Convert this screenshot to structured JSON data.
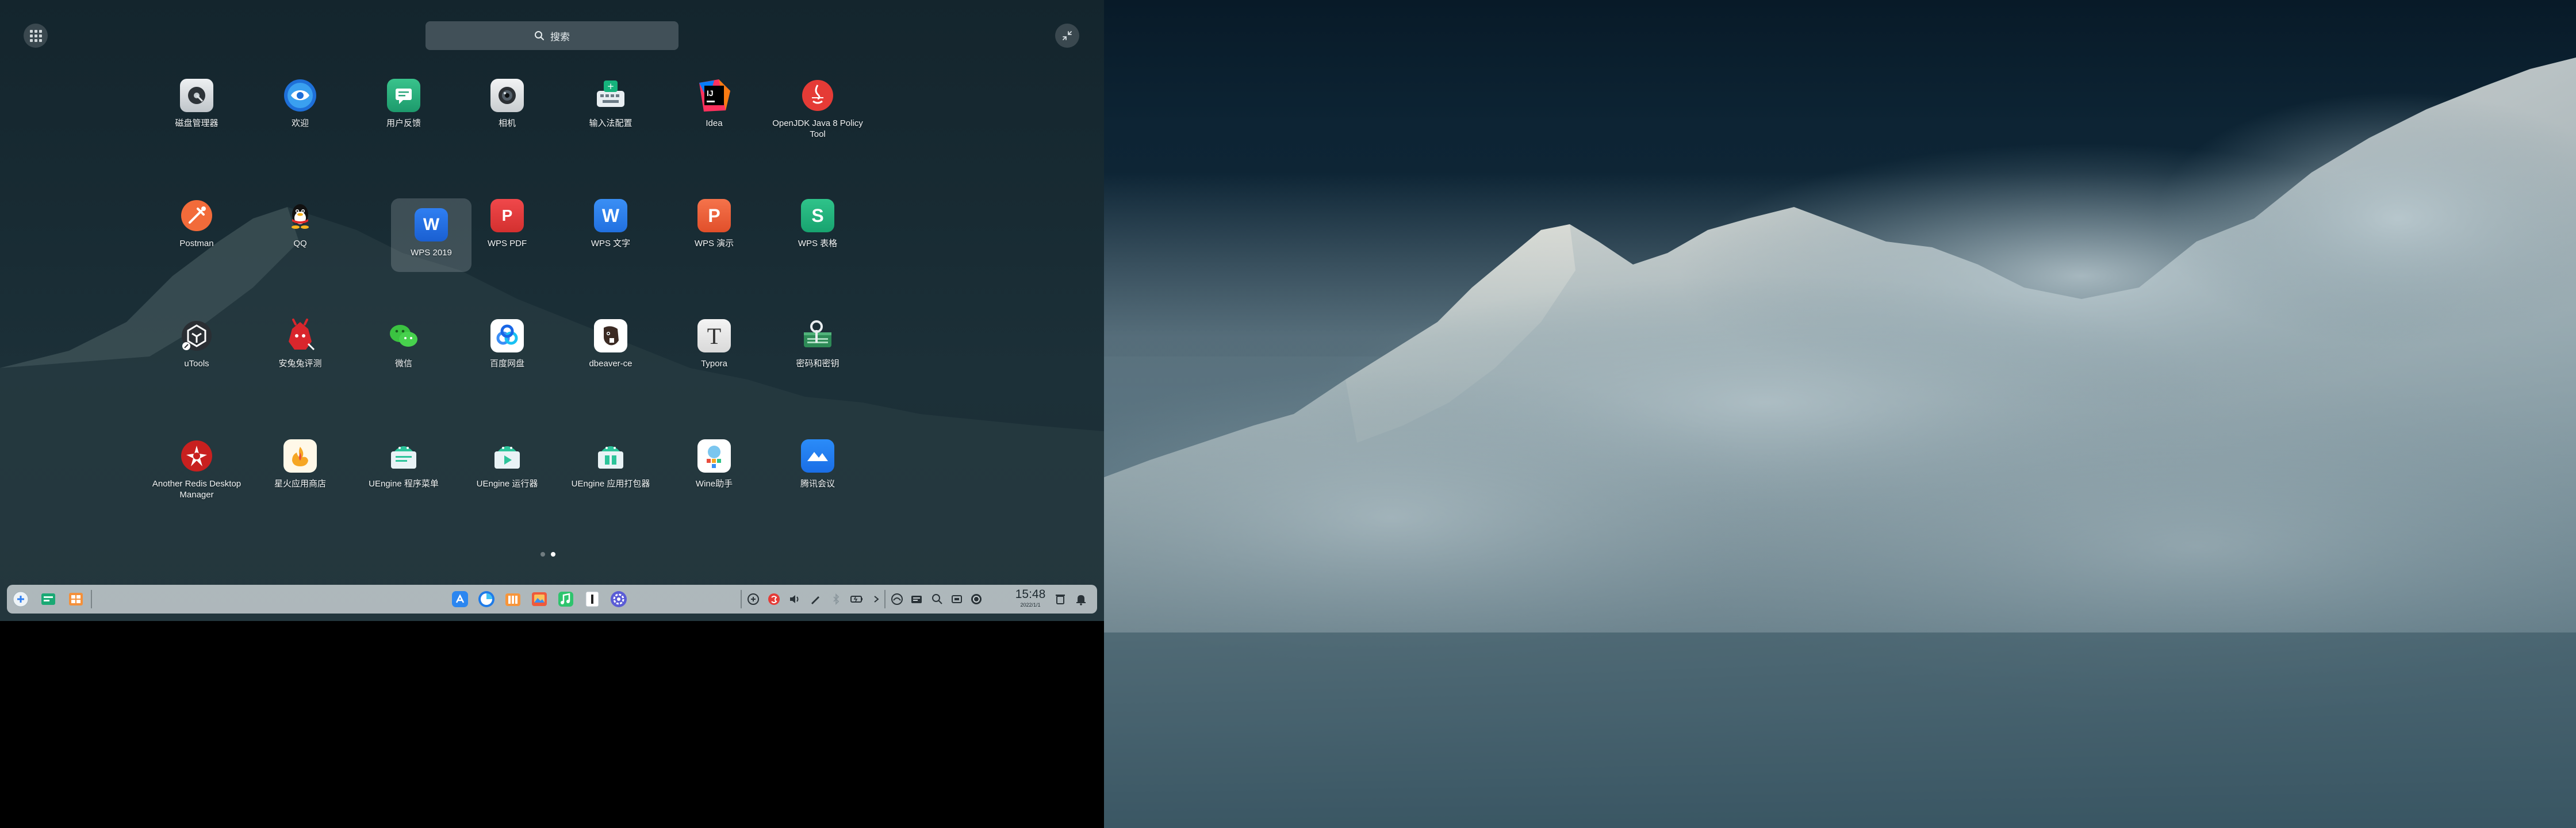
{
  "launcher": {
    "search_placeholder": "搜索",
    "apps": [
      {
        "label": "磁盘管理器",
        "icon": "disk-manager-icon"
      },
      {
        "label": "欢迎",
        "icon": "welcome-icon"
      },
      {
        "label": "用户反馈",
        "icon": "feedback-icon"
      },
      {
        "label": "相机",
        "icon": "camera-icon"
      },
      {
        "label": "输入法配置",
        "icon": "input-method-icon"
      },
      {
        "label": "Idea",
        "icon": "intellij-idea-icon"
      },
      {
        "label": "OpenJDK Java 8 Policy Tool",
        "icon": "java-icon"
      },
      {
        "label": "Postman",
        "icon": "postman-icon"
      },
      {
        "label": "QQ",
        "icon": "qq-icon"
      },
      {
        "label": "WPS 2019",
        "icon": "wps-2019-icon"
      },
      {
        "label": "WPS PDF",
        "icon": "wps-pdf-icon"
      },
      {
        "label": "WPS 文字",
        "icon": "wps-writer-icon"
      },
      {
        "label": "WPS 演示",
        "icon": "wps-presentation-icon"
      },
      {
        "label": "WPS 表格",
        "icon": "wps-spreadsheet-icon"
      },
      {
        "label": "uTools",
        "icon": "utools-icon"
      },
      {
        "label": "安兔兔评测",
        "icon": "antutu-icon"
      },
      {
        "label": "微信",
        "icon": "wechat-icon"
      },
      {
        "label": "百度网盘",
        "icon": "baidu-netdisk-icon"
      },
      {
        "label": "dbeaver-ce",
        "icon": "dbeaver-icon"
      },
      {
        "label": "Typora",
        "icon": "typora-icon"
      },
      {
        "label": "密码和密钥",
        "icon": "passwords-keys-icon"
      },
      {
        "label": "Another Redis Desktop Manager",
        "icon": "redis-icon"
      },
      {
        "label": "星火应用商店",
        "icon": "spark-store-icon"
      },
      {
        "label": "UEngine 程序菜单",
        "icon": "uengine-menu-icon"
      },
      {
        "label": "UEngine 运行器",
        "icon": "uengine-runner-icon"
      },
      {
        "label": "UEngine 应用打包器",
        "icon": "uengine-packager-icon"
      },
      {
        "label": "Wine助手",
        "icon": "wine-helper-icon"
      },
      {
        "label": "腾讯会议",
        "icon": "tencent-meeting-icon"
      }
    ],
    "selected_app": "WPS 2019",
    "pages": 2,
    "current_page": 2
  },
  "taskbar": {
    "clock_time": "15:48",
    "clock_date": "2022/1/1"
  }
}
